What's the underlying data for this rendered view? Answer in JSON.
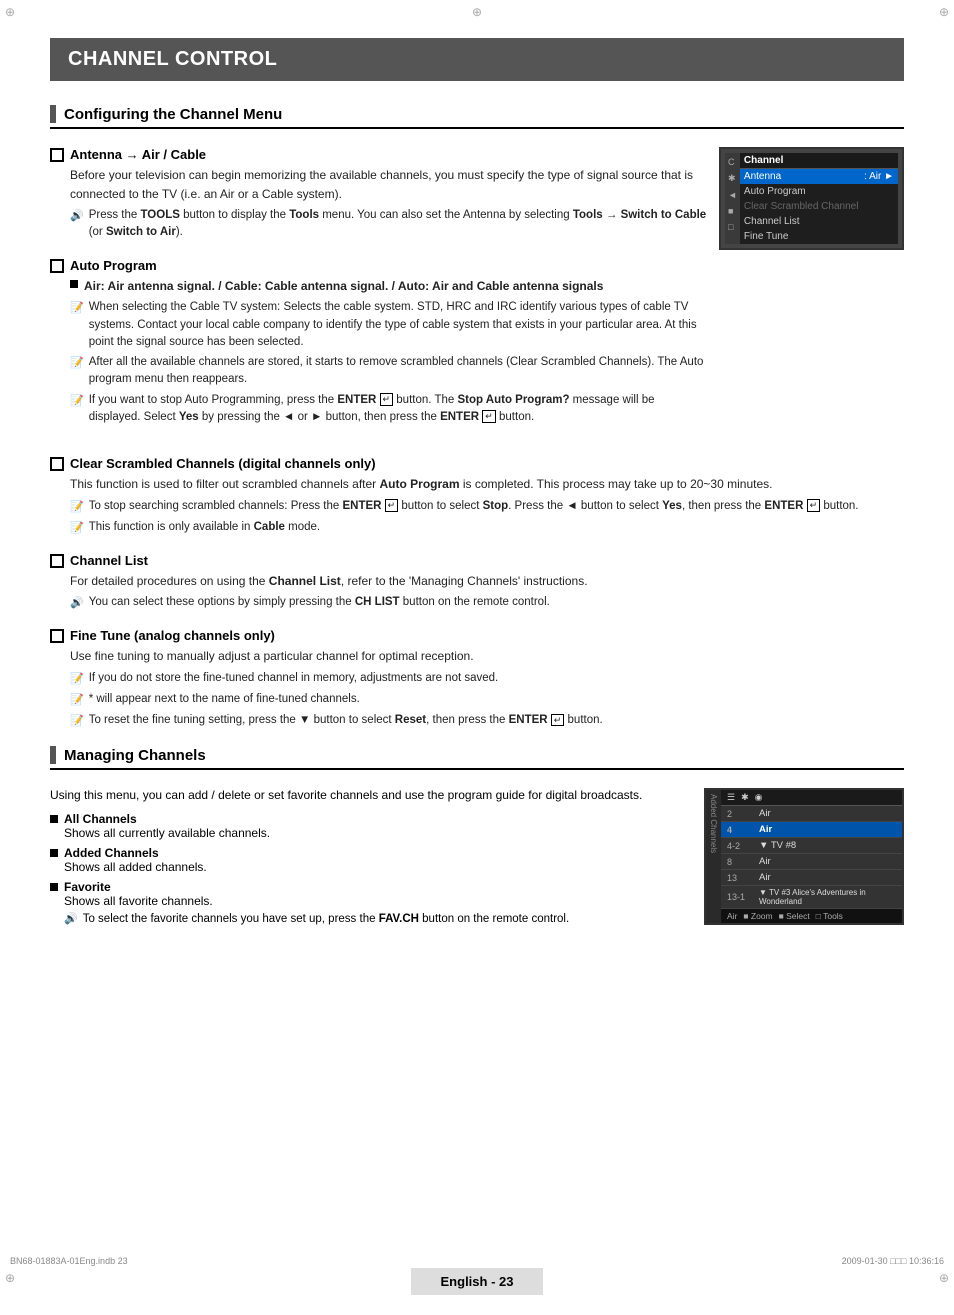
{
  "page": {
    "title": "CHANNEL CONTROL",
    "section1": {
      "heading": "Configuring the Channel Menu",
      "antenna": {
        "title": "Antenna → Air / Cable",
        "body": "Before your television can begin memorizing the available channels, you must specify the type of signal source that is connected to the TV (i.e. an Air or a Cable system).",
        "note1": "Press the TOOLS button to display the Tools menu. You can also set the Antenna by selecting Tools → Switch to Cable (or Switch to Air)."
      },
      "auto_program": {
        "title": "Auto Program",
        "bullet1_title": "Air: Air antenna signal. / Cable: Cable antenna signal. / Auto: Air and Cable antenna signals",
        "note1": "When selecting the Cable TV system: Selects the cable system. STD, HRC and IRC identify various types of cable TV systems. Contact your local cable company to identify the type of cable system that exists in your particular area. At this point the signal source has been selected.",
        "note2": "After all the available channels are stored, it starts to remove scrambled channels (Clear Scrambled Channels). The Auto program menu then reappears.",
        "note3": "If you want to stop Auto Programming, press the ENTER button. The Stop Auto Program? message will be displayed. Select Yes by pressing the ◄ or ► button, then press the ENTER button."
      },
      "clear_scrambled": {
        "title": "Clear Scrambled Channels (digital channels only)",
        "body": "This function is used to filter out scrambled channels after Auto Program is completed. This process may take up to 20~30 minutes.",
        "note1": "To stop searching scrambled channels: Press the ENTER button to select Stop. Press the ◄ button to select Yes, then press the ENTER button.",
        "note2": "This function is only available in Cable mode."
      },
      "channel_list": {
        "title": "Channel List",
        "body": "For detailed procedures on using the Channel List, refer to the 'Managing Channels' instructions.",
        "note1": "You can select these options by simply pressing the CH LIST button on the remote control."
      },
      "fine_tune": {
        "title": "Fine Tune (analog channels only)",
        "body": "Use fine tuning to manually adjust a particular channel for optimal reception.",
        "note1": "If you do not store the fine-tuned channel in memory, adjustments are not saved.",
        "note2": "* will appear next to the name of fine-tuned channels.",
        "note3": "To reset the fine tuning setting, press the ▼ button to select Reset, then press the ENTER button."
      }
    },
    "section2": {
      "heading": "Managing Channels",
      "intro": "Using this menu, you can add / delete or set favorite channels and use the program guide for digital broadcasts.",
      "all_channels": {
        "title": "All Channels",
        "body": "Shows all currently available channels."
      },
      "added_channels": {
        "title": "Added Channels",
        "body": "Shows all added channels."
      },
      "favorite": {
        "title": "Favorite",
        "body": "Shows all favorite channels.",
        "note1": "To select the favorite channels you have set up, press the FAV.CH button on the remote control."
      }
    },
    "tv_menu": {
      "header_label": "Channel",
      "antenna_row": "Antenna",
      "antenna_value": ": Air",
      "auto_program": "Auto Program",
      "clear_scrambled": "Clear Scrambled Channel",
      "channel_list": "Channel List",
      "fine_tune": "Fine Tune"
    },
    "tv_channels": {
      "header": "Added Channels",
      "rows": [
        {
          "ch": "2",
          "name": "Air",
          "selected": false
        },
        {
          "ch": "4",
          "name": "Air",
          "selected": true
        },
        {
          "ch": "4-2",
          "name": "▼ TV #8",
          "selected": false
        },
        {
          "ch": "8",
          "name": "Air",
          "selected": false
        },
        {
          "ch": "13",
          "name": "Air",
          "selected": false
        },
        {
          "ch": "13-1",
          "name": "▼ TV #3   Alice's Adventures in Wonderland",
          "selected": false
        }
      ],
      "footer": "Air    ■ Zoom   ■ Select   □ Tools"
    },
    "footer": {
      "page_label": "English - 23",
      "left_meta": "BN68-01883A-01Eng.indb   23",
      "right_meta": "2009-01-30   □□□ 10:36:16"
    }
  }
}
